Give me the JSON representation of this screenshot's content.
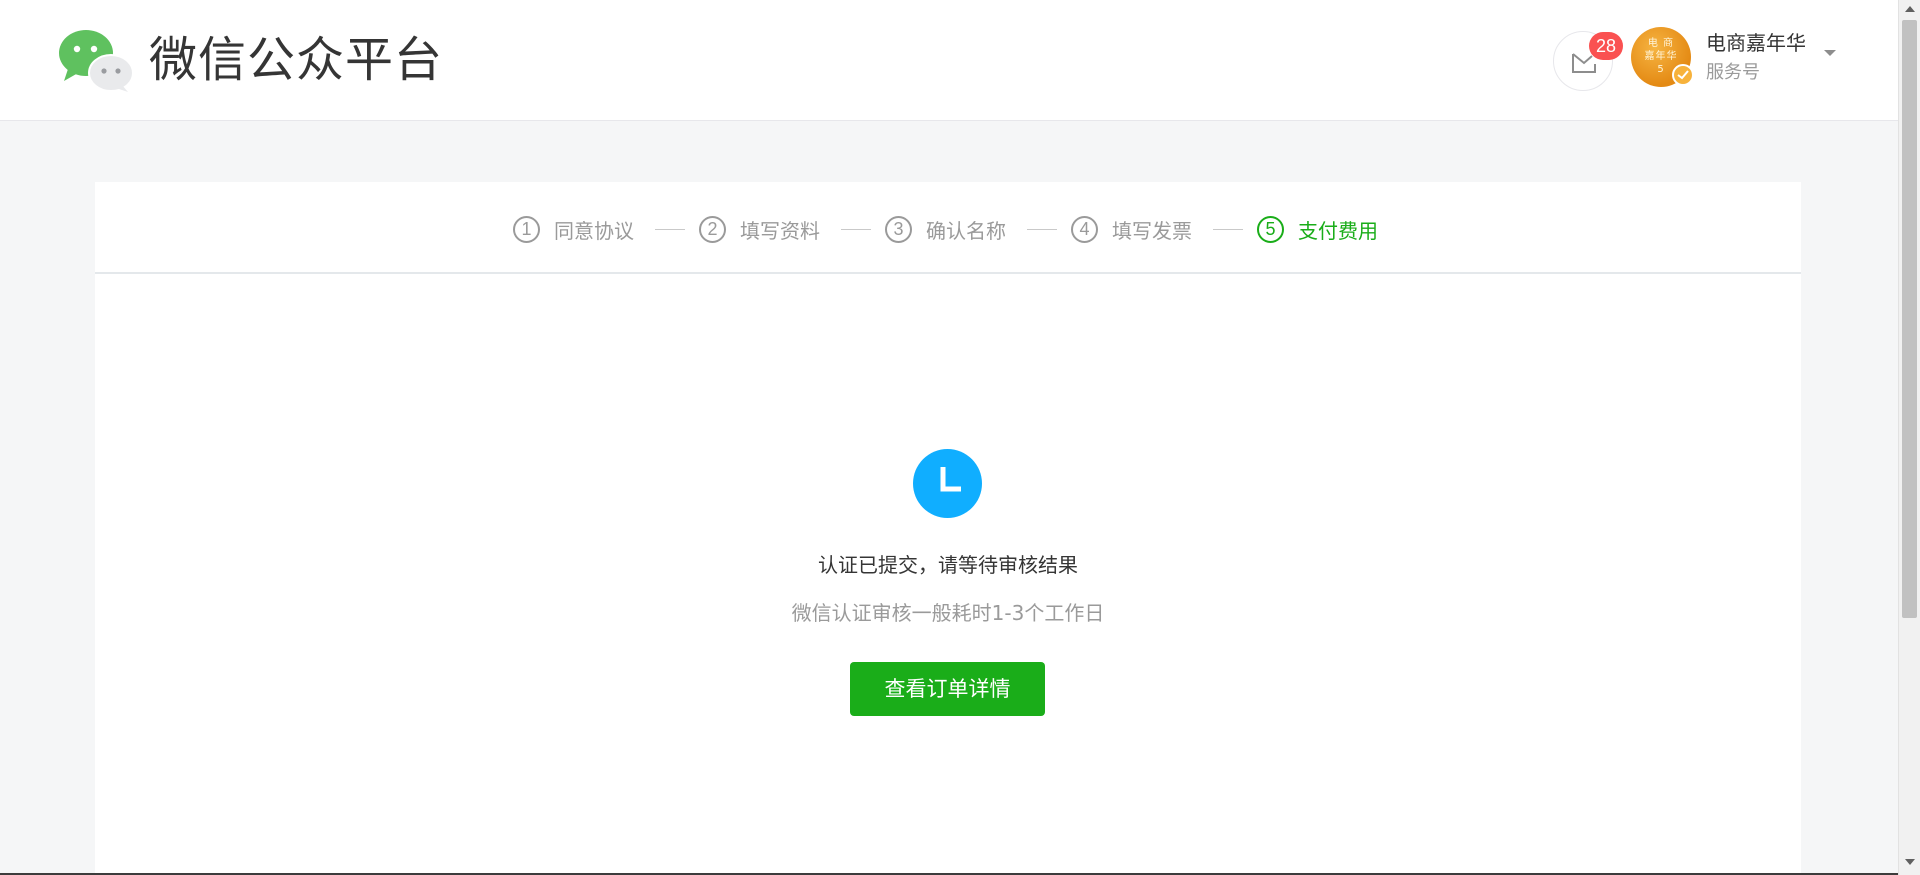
{
  "header": {
    "brand_title": "微信公众平台",
    "message_count": "28",
    "avatar_text": "电 商\n嘉年华\n5",
    "account_name": "电商嘉年华",
    "account_type": "服务号"
  },
  "steps": [
    {
      "number": "1",
      "label": "同意协议",
      "active": false
    },
    {
      "number": "2",
      "label": "填写资料",
      "active": false
    },
    {
      "number": "3",
      "label": "确认名称",
      "active": false
    },
    {
      "number": "4",
      "label": "填写发票",
      "active": false
    },
    {
      "number": "5",
      "label": "支付费用",
      "active": true
    }
  ],
  "result": {
    "title": "认证已提交，请等待审核结果",
    "description": "微信认证审核一般耗时1-3个工作日",
    "button_label": "查看订单详情"
  },
  "colors": {
    "accent_green": "#1aad19",
    "clock_blue": "#10aeff",
    "badge_red": "#fa5151",
    "page_bg": "#f5f6f7"
  },
  "icons": {
    "logo": "wechat-logo-icon",
    "message": "message-envelope-icon",
    "status": "clock-icon",
    "dropdown": "caret-down-icon",
    "verified": "verified-check-icon"
  }
}
